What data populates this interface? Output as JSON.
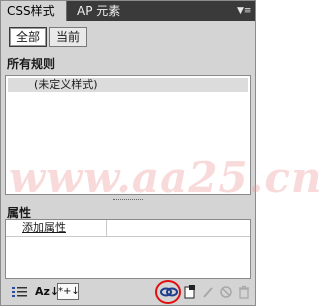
{
  "tabs": [
    {
      "label": "CSS样式"
    },
    {
      "label": "AP 元素"
    }
  ],
  "mode_buttons": {
    "all_label": "全部",
    "current_label": "当前"
  },
  "sections": {
    "rules_title": "所有规则",
    "rule_item": "(未定义样式)",
    "props_title": "属性",
    "add_property": "添加属性"
  },
  "toolbar": {
    "icons": [
      "category-view-icon",
      "alphabetical-view-icon",
      "set-properties-view-icon",
      "attach-style-sheet-icon",
      "new-css-rule-icon",
      "edit-style-icon",
      "disable-css-property-icon",
      "delete-css-rule-icon"
    ],
    "sort_label": "Az↓",
    "set_label": "*+↓"
  },
  "watermark": "www.aa25.cn",
  "colors": {
    "tab_bar": "#3a3a3a",
    "panel_bg": "#d4d4d4",
    "highlight": "#e01010"
  }
}
